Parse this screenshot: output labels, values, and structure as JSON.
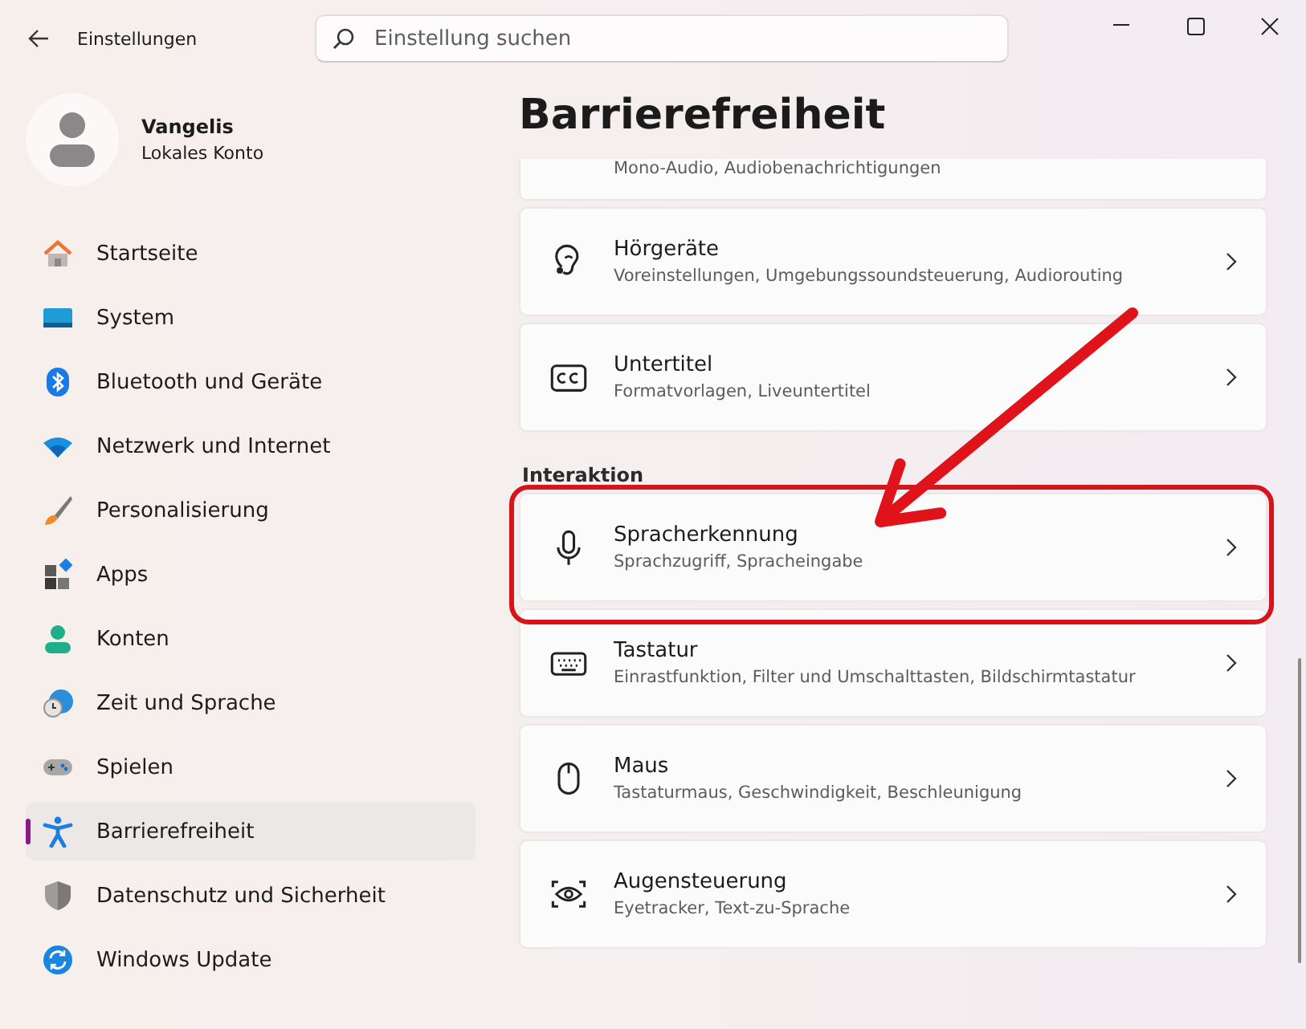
{
  "window": {
    "title": "Einstellungen"
  },
  "search": {
    "placeholder": "Einstellung suchen"
  },
  "account": {
    "name": "Vangelis",
    "type": "Lokales Konto"
  },
  "sidebar": {
    "items": [
      {
        "label": "Startseite",
        "selected": false
      },
      {
        "label": "System",
        "selected": false
      },
      {
        "label": "Bluetooth und Geräte",
        "selected": false
      },
      {
        "label": "Netzwerk und Internet",
        "selected": false
      },
      {
        "label": "Personalisierung",
        "selected": false
      },
      {
        "label": "Apps",
        "selected": false
      },
      {
        "label": "Konten",
        "selected": false
      },
      {
        "label": "Zeit und Sprache",
        "selected": false
      },
      {
        "label": "Spielen",
        "selected": false
      },
      {
        "label": "Barrierefreiheit",
        "selected": true
      },
      {
        "label": "Datenschutz und Sicherheit",
        "selected": false
      },
      {
        "label": "Windows Update",
        "selected": false
      }
    ]
  },
  "page": {
    "title": "Barrierefreiheit",
    "sections": [
      {
        "items": [
          {
            "kind": "partial",
            "subtitle": "Mono-Audio, Audiobenachrichtigungen",
            "highlighted": false
          },
          {
            "kind": "link",
            "title": "Hörgeräte",
            "subtitle": "Voreinstellungen, Umgebungssoundsteuerung, Audiorouting",
            "highlighted": false
          },
          {
            "kind": "link",
            "title": "Untertitel",
            "subtitle": "Formatvorlagen, Liveuntertitel",
            "highlighted": false
          }
        ]
      },
      {
        "heading": "Interaktion",
        "items": [
          {
            "kind": "link",
            "title": "Spracherkennung",
            "subtitle": "Sprachzugriff, Spracheingabe",
            "highlighted": true
          },
          {
            "kind": "link",
            "title": "Tastatur",
            "subtitle": "Einrastfunktion, Filter und Umschalttasten, Bildschirmtastatur",
            "highlighted": false
          },
          {
            "kind": "link",
            "title": "Maus",
            "subtitle": "Tastaturmaus, Geschwindigkeit, Beschleunigung",
            "highlighted": false
          },
          {
            "kind": "link",
            "title": "Augensteuerung",
            "subtitle": "Eyetracker, Text-zu-Sprache",
            "highlighted": false
          }
        ]
      }
    ]
  }
}
